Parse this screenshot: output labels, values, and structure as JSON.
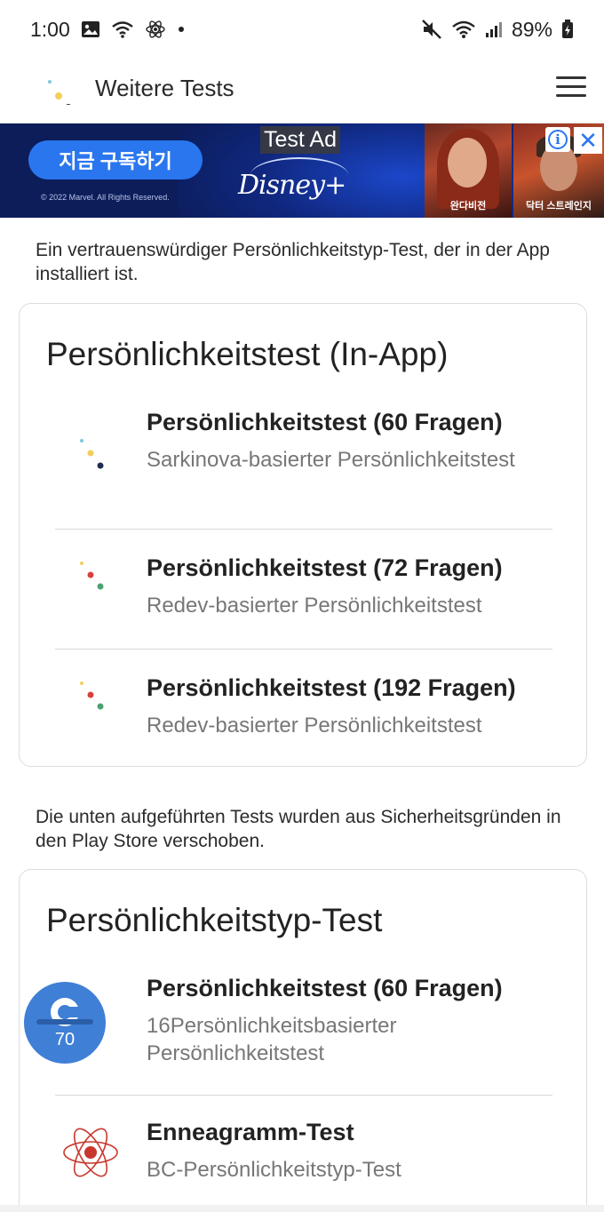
{
  "status_bar": {
    "time": "1:00",
    "battery": "89%",
    "icons": [
      "image-icon",
      "wifi-call-icon",
      "atom-icon",
      "dot-icon",
      "mute-icon",
      "wifi-icon",
      "signal-icon",
      "battery-icon"
    ]
  },
  "app_bar": {
    "title": "Weitere Tests",
    "menu_icon": "hamburger-menu-icon"
  },
  "ad": {
    "label": "Test Ad",
    "cta": "지금 구독하기",
    "copyright": "© 2022 Marvel. All Rights Reserved.",
    "brand": "Disney+",
    "poster_1_caption": "완다비전",
    "poster_2_caption": "닥터 스트레인지",
    "info_glyph": "i",
    "close_glyph": "✕"
  },
  "in_app_section": {
    "intro": "Ein vertrauenswürdiger Persönlichkeitstyp-Test, der in der App installiert ist.",
    "card_title": "Persönlichkeitstest (In-App)",
    "items": [
      {
        "title": "Persönlichkeitstest (60 Fragen)",
        "subtitle": "Sarkinova-basierter Persönlichkeitstest",
        "icon": "dots-blue-icon"
      },
      {
        "title": "Persönlichkeitstest (72 Fragen)",
        "subtitle": "Redev-basierter Persönlichkeitstest",
        "icon": "dots-red-green-icon"
      },
      {
        "title": "Persönlichkeitstest (192 Fragen)",
        "subtitle": "Redev-basierter Persönlichkeitstest",
        "icon": "dots-red-green-icon"
      }
    ]
  },
  "play_store_section": {
    "intro": "Die unten aufgeführten Tests wurden aus Sicherheitsgründen in den Play Store verschoben.",
    "card_title": "Persönlichkeitstyp-Test",
    "items": [
      {
        "title": "Persönlichkeitstest (60 Fragen)",
        "subtitle": "16Persönlichkeitsbasierter Persönlichkeitstest",
        "icon": "badge-70-icon",
        "badge_number": "70"
      },
      {
        "title": "Enneagramm-Test",
        "subtitle": "BC-Persönlichkeitstyp-Test",
        "icon": "atom-icon"
      }
    ]
  },
  "colors": {
    "ad_background": "#0c1d5a",
    "ad_cta": "#2a76ee",
    "badge_blue": "#3f7fd6",
    "dot_yellow": "#f2cf5b",
    "dot_navy": "#1f2d4f",
    "dot_red": "#d8403a",
    "dot_green": "#4aa374",
    "atom_red": "#c9372c"
  }
}
